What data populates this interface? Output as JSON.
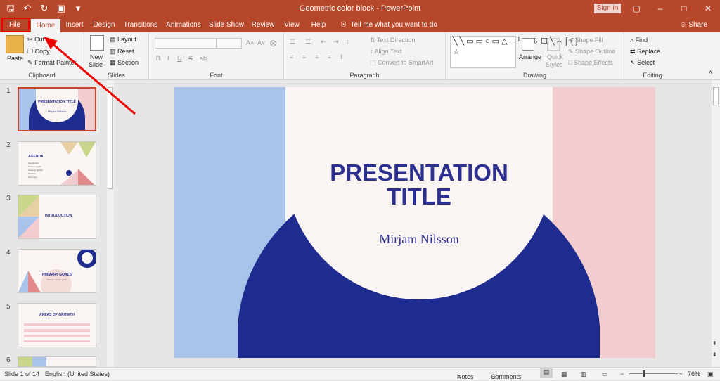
{
  "window": {
    "title": "Geometric color block  -  PowerPoint",
    "sign_in": "Sign in",
    "share": "Share"
  },
  "tabs": [
    "File",
    "Home",
    "Insert",
    "Design",
    "Transitions",
    "Animations",
    "Slide Show",
    "Review",
    "View",
    "Help"
  ],
  "tell_me": "Tell me what you want to do",
  "ribbon": {
    "clipboard": {
      "label": "Clipboard",
      "paste": "Paste",
      "cut": "Cut",
      "copy": "Copy",
      "format_painter": "Format Painter"
    },
    "slides": {
      "label": "Slides",
      "new_slide": "New",
      "new_slide2": "Slide",
      "layout": "Layout",
      "reset": "Reset",
      "section": "Section"
    },
    "font": {
      "label": "Font",
      "bold": "B",
      "italic": "I",
      "underline": "U",
      "strike": "S",
      "shadow": "ab"
    },
    "paragraph": {
      "label": "Paragraph",
      "text_direction": "Text Direction",
      "align_text": "Align Text",
      "convert_smartart": "Convert to SmartArt"
    },
    "drawing": {
      "label": "Drawing",
      "arrange": "Arrange",
      "quick_styles": "Quick",
      "quick_styles2": "Styles",
      "shape_fill": "Shape Fill",
      "shape_outline": "Shape Outline",
      "shape_effects": "Shape Effects"
    },
    "editing": {
      "label": "Editing",
      "find": "Find",
      "replace": "Replace",
      "select": "Select"
    }
  },
  "thumbnails": [
    {
      "num": "1",
      "title": "PRESENTATION TITLE",
      "sub": "Mirjam Nilsson"
    },
    {
      "num": "2",
      "title": "AGENDA",
      "items": [
        "Introduction",
        "Primary goals",
        "Areas of growth",
        "Timeline",
        "Summary"
      ]
    },
    {
      "num": "3",
      "title": "INTRODUCTION"
    },
    {
      "num": "4",
      "title": "PRIMARY GOALS",
      "sub": "Sample text for goals"
    },
    {
      "num": "5",
      "title": "AREAS OF GROWTH"
    },
    {
      "num": "6"
    }
  ],
  "slide": {
    "title_line1": "PRESENTATION",
    "title_line2": "TITLE",
    "subtitle": "Mirjam Nilsson"
  },
  "status": {
    "slide_of": "Slide 1 of 14",
    "language": "English (United States)",
    "notes": "Notes",
    "comments": "Comments",
    "zoom": "76%"
  },
  "colors": {
    "accent": "#b7472a",
    "navy": "#1f2c8f",
    "blue_block": "#a9c3ea",
    "pink_block": "#f3ccd0",
    "cream": "#faf5f2"
  }
}
